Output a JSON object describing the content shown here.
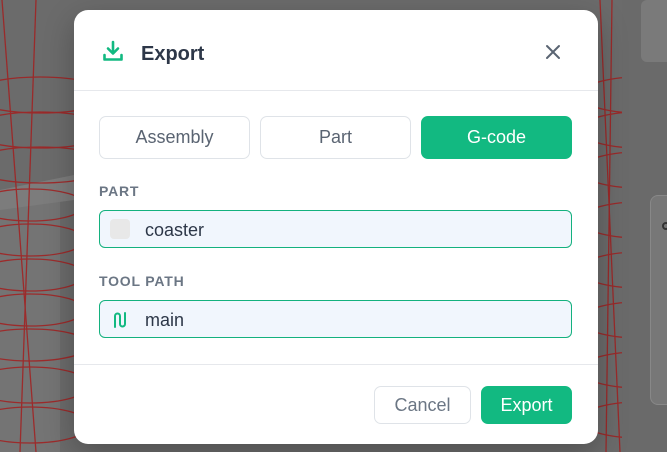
{
  "dialog": {
    "title": "Export",
    "icons": {
      "header": "download-icon",
      "close": "close-icon"
    },
    "tabs": [
      {
        "label": "Assembly",
        "active": false
      },
      {
        "label": "Part",
        "active": false
      },
      {
        "label": "G-code",
        "active": true
      }
    ],
    "part": {
      "label": "PART",
      "value": "coaster",
      "icon": "color-swatch-icon"
    },
    "tool_path": {
      "label": "TOOL PATH",
      "value": "main",
      "icon": "toolpath-icon"
    },
    "cancel_label": "Cancel",
    "export_label": "Export"
  },
  "colors": {
    "accent": "#12b981",
    "field_border": "#14b17e",
    "field_bg": "#f1f6fd",
    "title": "#2d3748",
    "muted": "#6b7684",
    "backdrop": "#6d6d6d",
    "cad_lines": "#b02020"
  }
}
